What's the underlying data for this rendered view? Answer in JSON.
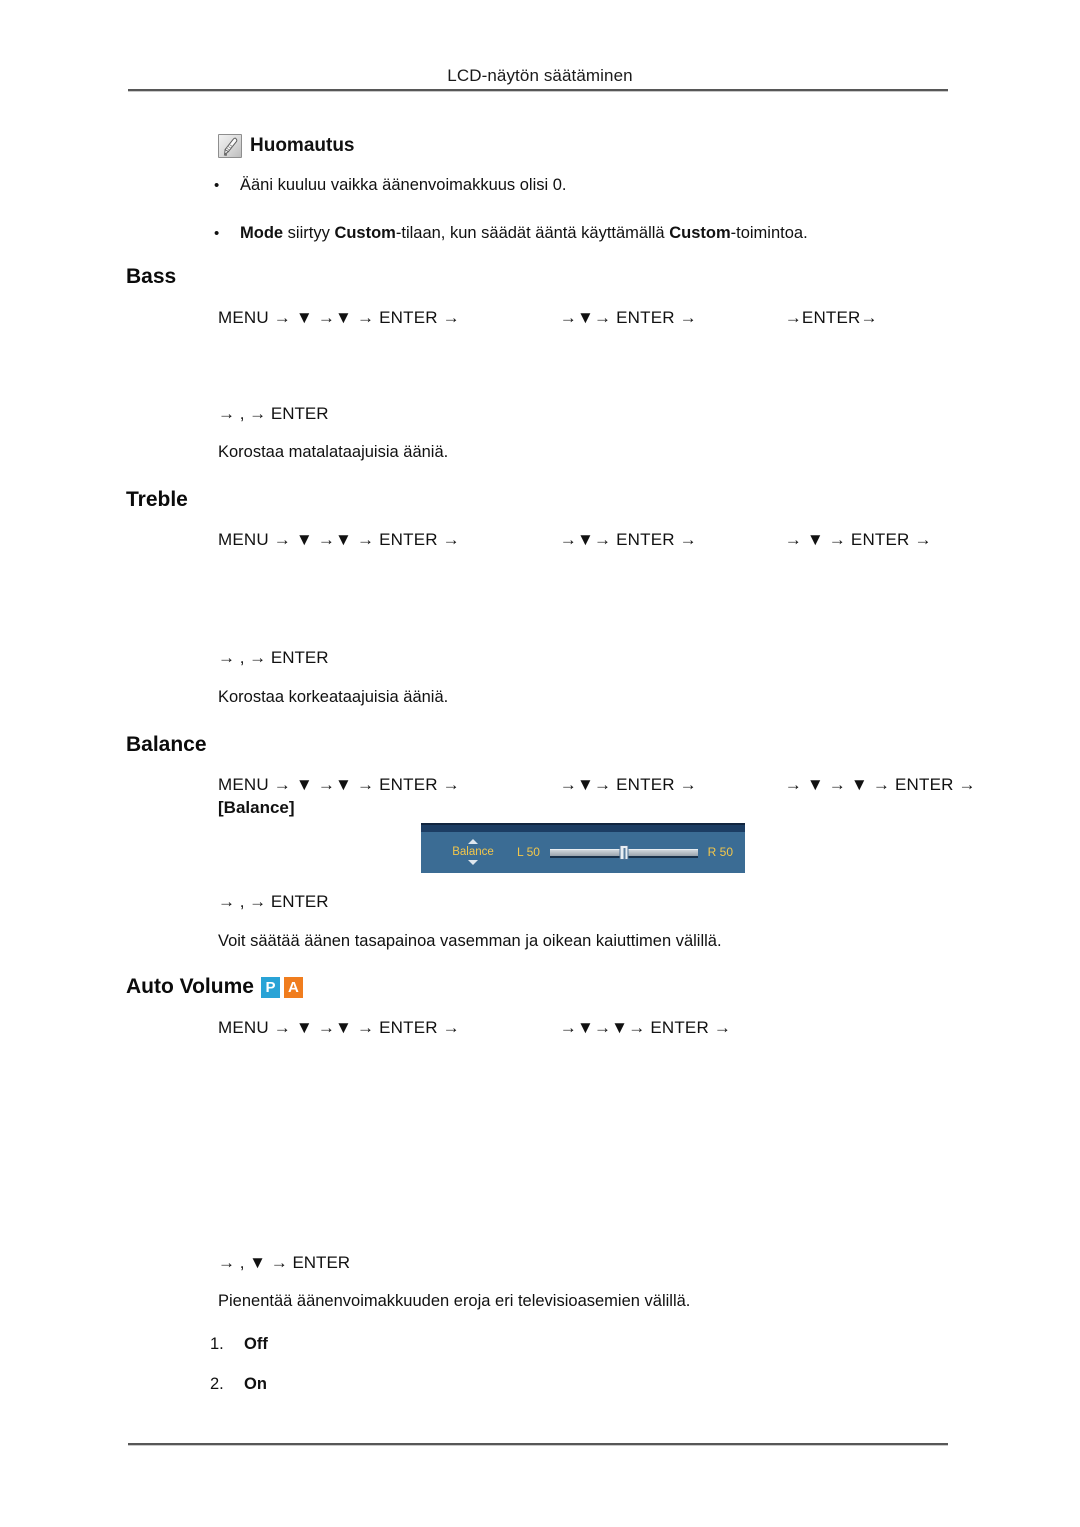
{
  "header": {
    "title": "LCD-näytön säätäminen"
  },
  "note": {
    "icon": "note-pen-icon",
    "label": "Huomautus",
    "bullet_marker": "•",
    "bullets": [
      {
        "parts": [
          {
            "text": "Ääni kuuluu vaikka äänenvoimakkuus olisi 0.",
            "bold": false
          }
        ]
      },
      {
        "parts": [
          {
            "text": "Mode",
            "bold": true
          },
          {
            "text": " siirtyy ",
            "bold": false
          },
          {
            "text": "Custom",
            "bold": true
          },
          {
            "text": "-tilaan, kun säädät ääntä käyttämällä ",
            "bold": false
          },
          {
            "text": "Custom",
            "bold": true
          },
          {
            "text": "-toimintoa.",
            "bold": false
          }
        ]
      }
    ]
  },
  "sections": {
    "bass": {
      "title": "Bass",
      "path_groups": [
        "MENU → ▼ →▼ → ENTER →",
        "→▼→ ENTER →",
        "→ENTER→"
      ],
      "tail": "→  ,  → ENTER",
      "description": "Korostaa matalataajuisia ääniä."
    },
    "treble": {
      "title": "Treble",
      "path_groups": [
        "MENU → ▼ →▼ → ENTER →",
        "→▼→ ENTER →",
        "→ ▼ → ENTER →"
      ],
      "tail": "→  ,  → ENTER",
      "description": "Korostaa korkeataajuisia ääniä."
    },
    "balance": {
      "title": "Balance",
      "path_groups": [
        "MENU → ▼ →▼ → ENTER →",
        "→▼→ ENTER →",
        "→ ▼ → ▼ → ENTER →"
      ],
      "path_suffix": "[Balance]",
      "tail": "→  ,  → ENTER",
      "description": "Voit säätää äänen tasapainoa vasemman ja oikean kaiuttimen välillä.",
      "osd": {
        "menu_label": "Balance",
        "left_label": "L  50",
        "right_label": "R  50",
        "thumb_percent": 50,
        "up_caret": "caret-up-icon",
        "down_caret": "caret-down-icon",
        "colors": {
          "background": "#3b6c94",
          "topbar": "#1c3d63",
          "text": "#f2c64b",
          "track": "#cfd6dc",
          "thumb": "#e9eef3"
        }
      }
    },
    "auto_volume": {
      "title": "Auto Volume",
      "badges": [
        {
          "letter": "P",
          "color": "#29a3d6",
          "name": "badge-p-icon"
        },
        {
          "letter": "A",
          "color": "#f07d1e",
          "name": "badge-a-icon"
        }
      ],
      "path_groups": [
        "MENU → ▼ →▼ → ENTER →",
        "→▼→▼→ ENTER →"
      ],
      "tail": "→   , ▼ → ENTER",
      "description": "Pienentää äänenvoimakkuuden eroja eri televisioasemien välillä.",
      "options": [
        {
          "num": "1.",
          "label": "Off"
        },
        {
          "num": "2.",
          "label": "On"
        }
      ]
    }
  }
}
